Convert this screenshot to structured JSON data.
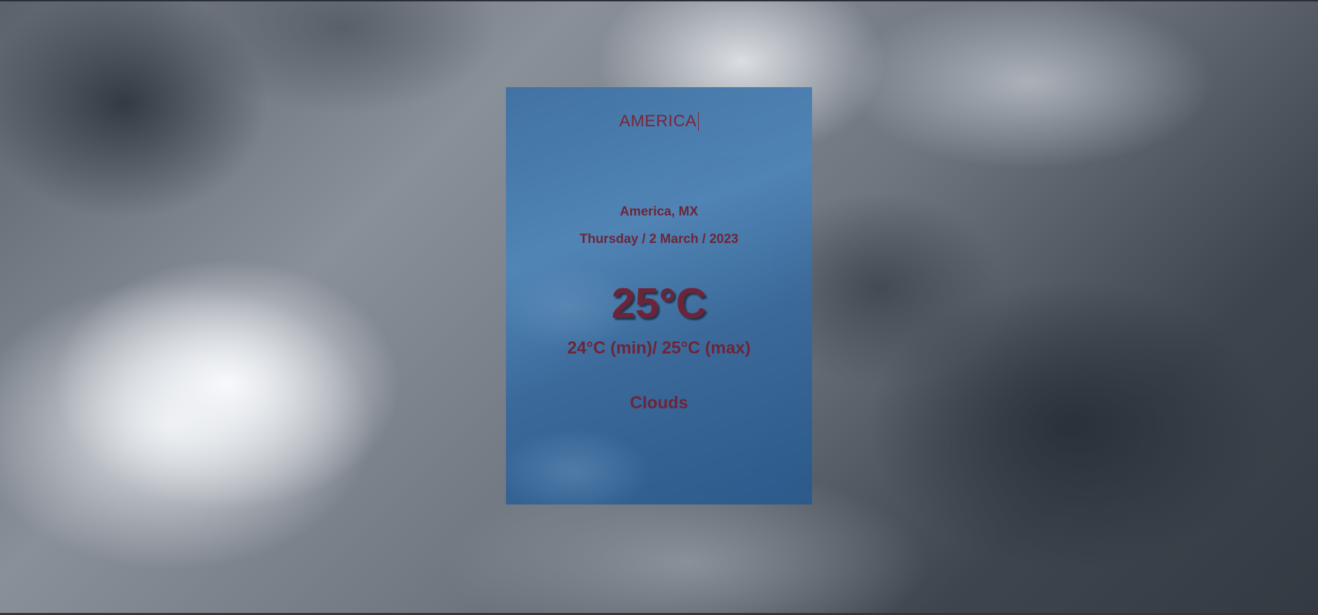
{
  "search": {
    "value": "AMERICA"
  },
  "weather": {
    "location": "America, MX",
    "date": "Thursday / 2 March / 2023",
    "temperature": "25°C",
    "range": "24°C (min)/ 25°C (max)",
    "condition": "Clouds"
  },
  "colors": {
    "text": "#6e2236",
    "card": "#3f72a3"
  }
}
